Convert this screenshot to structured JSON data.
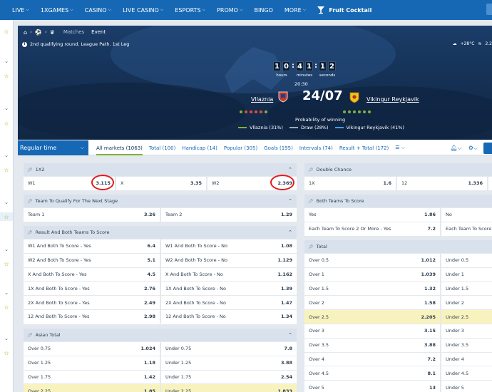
{
  "nav": {
    "items": [
      {
        "label": "LIVE",
        "chev": true
      },
      {
        "label": "1XGAMES",
        "chev": true
      },
      {
        "label": "CASINO",
        "chev": true
      },
      {
        "label": "LIVE CASINO",
        "chev": true
      },
      {
        "label": "ESPORTS",
        "chev": true
      },
      {
        "label": "PROMO",
        "chev": true
      },
      {
        "label": "BINGO",
        "chev": false
      },
      {
        "label": "MORE",
        "chev": true
      }
    ],
    "featured_label": "Fruit Cocktail"
  },
  "breadcrumb": {
    "tab_matches": "Matches",
    "tab_event": "Event"
  },
  "event": {
    "tournament": "2nd qualifying round. League Path. 1st Leg",
    "weather_temp": "+28°C",
    "weather_wind": "2.2",
    "timer": {
      "hours": [
        "1",
        "0"
      ],
      "minutes": [
        "4",
        "1"
      ],
      "seconds": [
        "1",
        "2"
      ],
      "hours_label": "hours",
      "minutes_label": "minutes",
      "seconds_label": "seconds"
    },
    "kickoff_time": "20:30",
    "date": "24/07",
    "team1": "Vllaznia",
    "team2": "Vikingur Reykjavik",
    "team1_form": [
      "#7fb23a",
      "#e74c3c",
      "#e74c3c",
      "#e74c3c",
      "#e74c3c",
      "#7fb23a"
    ],
    "team2_form": [
      "#7fb23a",
      "#7fb23a",
      "#7fb23a",
      "#7fb23a",
      "#7fb23a",
      "#7fb23a"
    ],
    "probability_title": "Probability of winning",
    "probabilities": [
      {
        "label": "Vllaznia (31%)",
        "color": "#7fb23a"
      },
      {
        "label": "Draw (28%)",
        "color": "#9aa8b8"
      },
      {
        "label": "Vikingur Reykjavik (41%)",
        "color": "#3aa0e8"
      }
    ]
  },
  "markets_bar": {
    "period": "Regular time",
    "tabs": [
      {
        "label": "All markets (1063)",
        "active": true
      },
      {
        "label": "Total (100)",
        "active": false
      },
      {
        "label": "Handicap (14)",
        "active": false
      },
      {
        "label": "Popular (305)",
        "active": false
      },
      {
        "label": "Goals (195)",
        "active": false
      },
      {
        "label": "Intervals (74)",
        "active": false
      },
      {
        "label": "Result + Total (172)",
        "active": false
      }
    ]
  },
  "markets": {
    "x1x2": {
      "title": "1X2",
      "cells": [
        {
          "label": "W1",
          "odd": "3.115"
        },
        {
          "label": "X",
          "odd": "3.35"
        },
        {
          "label": "W2",
          "odd": "2.369"
        }
      ]
    },
    "qualify": {
      "title": "Team To Qualify For The Next Stage",
      "cells": [
        {
          "label": "Team 1",
          "odd": "3.26"
        },
        {
          "label": "Team 2",
          "odd": "1.29"
        }
      ]
    },
    "result_btts": {
      "title": "Result And Both Teams To Score",
      "rows": [
        [
          {
            "label": "W1 And Both To Score - Yes",
            "odd": "6.4"
          },
          {
            "label": "W1 And Both To Score - No",
            "odd": "1.08"
          }
        ],
        [
          {
            "label": "W2 And Both To Score - Yes",
            "odd": "5.1"
          },
          {
            "label": "W2 And Both To Score - No",
            "odd": "1.129"
          }
        ],
        [
          {
            "label": "X And Both To Score - Yes",
            "odd": "4.5"
          },
          {
            "label": "X And Both To Score - No",
            "odd": "1.162"
          }
        ],
        [
          {
            "label": "1X And Both To Score - Yes",
            "odd": "2.76"
          },
          {
            "label": "1X And Both To Score - No",
            "odd": "1.39"
          }
        ],
        [
          {
            "label": "2X And Both To Score - Yes",
            "odd": "2.49"
          },
          {
            "label": "2X And Both To Score - No",
            "odd": "1.47"
          }
        ],
        [
          {
            "label": "12 And Both To Score - Yes",
            "odd": "2.98"
          },
          {
            "label": "12 And Both To Score - No",
            "odd": "1.34"
          }
        ]
      ]
    },
    "asian_total": {
      "title": "Asian Total",
      "rows": [
        [
          {
            "label": "Over 0.75",
            "odd": "1.024"
          },
          {
            "label": "Under 0.75",
            "odd": "7.8"
          }
        ],
        [
          {
            "label": "Over 1.25",
            "odd": "1.18"
          },
          {
            "label": "Under 1.25",
            "odd": "3.88"
          }
        ],
        [
          {
            "label": "Over 1.75",
            "odd": "1.42"
          },
          {
            "label": "Under 1.75",
            "odd": "2.54"
          }
        ],
        [
          {
            "label": "Over 2.25",
            "odd": "1.85",
            "hl": true
          },
          {
            "label": "Under 2.25",
            "odd": "1.833",
            "hl": true
          }
        ]
      ]
    },
    "double_chance": {
      "title": "Double Chance",
      "cells": [
        {
          "label": "1X",
          "odd": "1.6"
        },
        {
          "label": "12",
          "odd": "1.336"
        }
      ]
    },
    "btts": {
      "title": "Both Teams To Score",
      "rows": [
        [
          {
            "label": "Yes",
            "odd": "1.86"
          },
          {
            "label": "No",
            "odd": ""
          }
        ],
        [
          {
            "label": "Each Team To Score 2 Or More - Yes",
            "odd": "7.2"
          },
          {
            "label": "Each Team To Score",
            "odd": ""
          }
        ]
      ]
    },
    "total": {
      "title": "Total",
      "rows": [
        [
          {
            "label": "Over 0.5",
            "odd": "1.012"
          },
          {
            "label": "Under 0.5",
            "odd": ""
          }
        ],
        [
          {
            "label": "Over 1",
            "odd": "1.039"
          },
          {
            "label": "Under 1",
            "odd": ""
          }
        ],
        [
          {
            "label": "Over 1.5",
            "odd": "1.32"
          },
          {
            "label": "Under 1.5",
            "odd": ""
          }
        ],
        [
          {
            "label": "Over 2",
            "odd": "1.58"
          },
          {
            "label": "Under 2",
            "odd": ""
          }
        ],
        [
          {
            "label": "Over 2.5",
            "odd": "2.205",
            "hl": true
          },
          {
            "label": "Under 2.5",
            "odd": "",
            "hl": true
          }
        ],
        [
          {
            "label": "Over 3",
            "odd": "3.15"
          },
          {
            "label": "Under 3",
            "odd": ""
          }
        ],
        [
          {
            "label": "Over 3.5",
            "odd": "3.88"
          },
          {
            "label": "Under 3.5",
            "odd": ""
          }
        ],
        [
          {
            "label": "Over 4",
            "odd": "7.2"
          },
          {
            "label": "Under 4",
            "odd": ""
          }
        ],
        [
          {
            "label": "Over 4.5",
            "odd": "8.1"
          },
          {
            "label": "Under 4.5",
            "odd": ""
          }
        ],
        [
          {
            "label": "Over 5",
            "odd": "13"
          },
          {
            "label": "Under 5",
            "odd": ""
          }
        ]
      ]
    }
  },
  "colors": {
    "brand": "#1668b4",
    "header_bg": "#d9e2ec",
    "highlight": "#f8f3be",
    "annotation": "#e11c1c"
  }
}
